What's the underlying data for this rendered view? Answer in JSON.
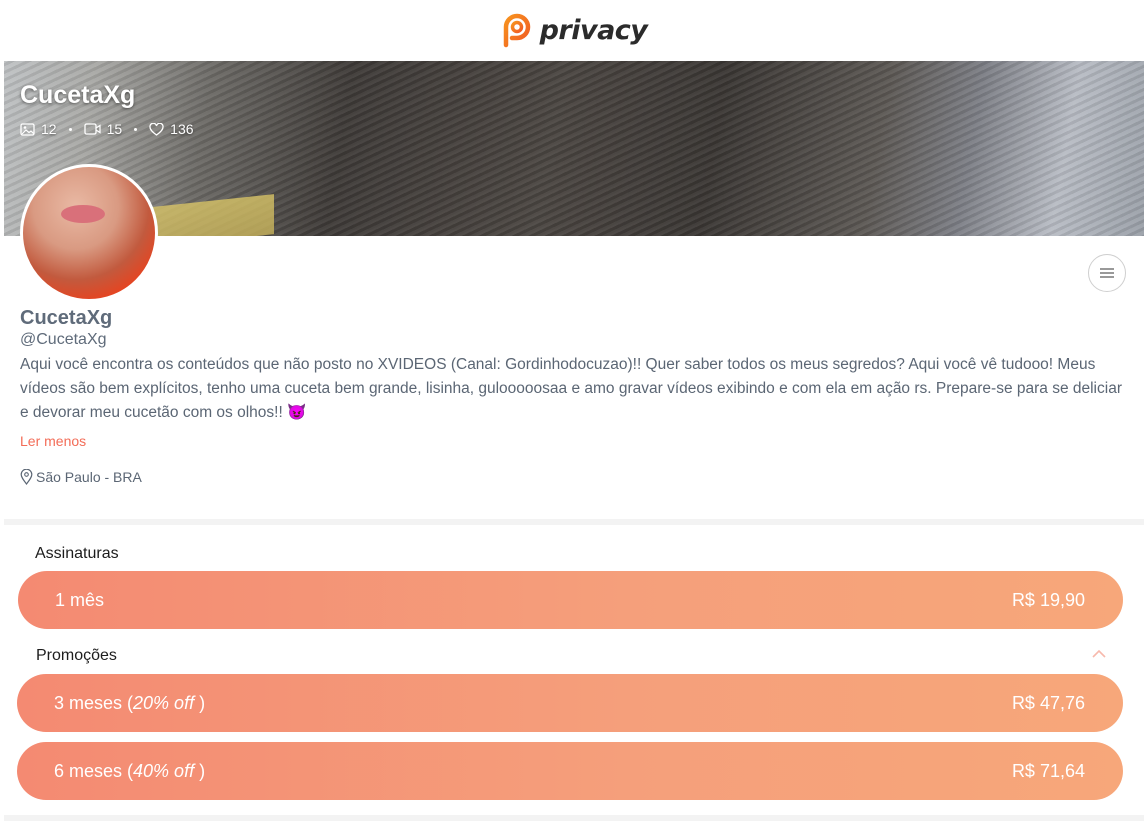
{
  "header": {
    "logo_text": "privacy"
  },
  "banner": {
    "title": "CucetaXg",
    "stats": {
      "photos": "12",
      "videos": "15",
      "likes": "136"
    }
  },
  "profile": {
    "name": "CucetaXg",
    "handle": "@CucetaXg",
    "bio": "Aqui você encontra os conteúdos que não posto no XVIDEOS (Canal: Gordinhodocuzao)!! Quer saber todos os meus segredos? Aqui você vê tudooo! Meus vídeos são bem explícitos, tenho uma cuceta bem grande, lisinha, gulooooosaa e amo gravar vídeos exibindo e com ela em ação rs. Prepare-se para se deliciar e devorar meu cucetão com os olhos!! 😈",
    "read_less": "Ler menos",
    "location": "São Paulo - BRA"
  },
  "subscriptions": {
    "title": "Assinaturas",
    "plans": [
      {
        "label": "1 mês",
        "price": "R$ 19,90"
      }
    ]
  },
  "promotions": {
    "title": "Promoções",
    "plans": [
      {
        "label_prefix": "3 meses (",
        "discount": "20% off",
        "label_suffix": " )",
        "price": "R$ 47,76"
      },
      {
        "label_prefix": "6 meses (",
        "discount": "40% off",
        "label_suffix": " )",
        "price": "R$ 71,64"
      }
    ]
  },
  "colors": {
    "accent": "#f36c57",
    "plan_gradient_start": "#f48a72",
    "plan_gradient_end": "#f7a77a"
  }
}
